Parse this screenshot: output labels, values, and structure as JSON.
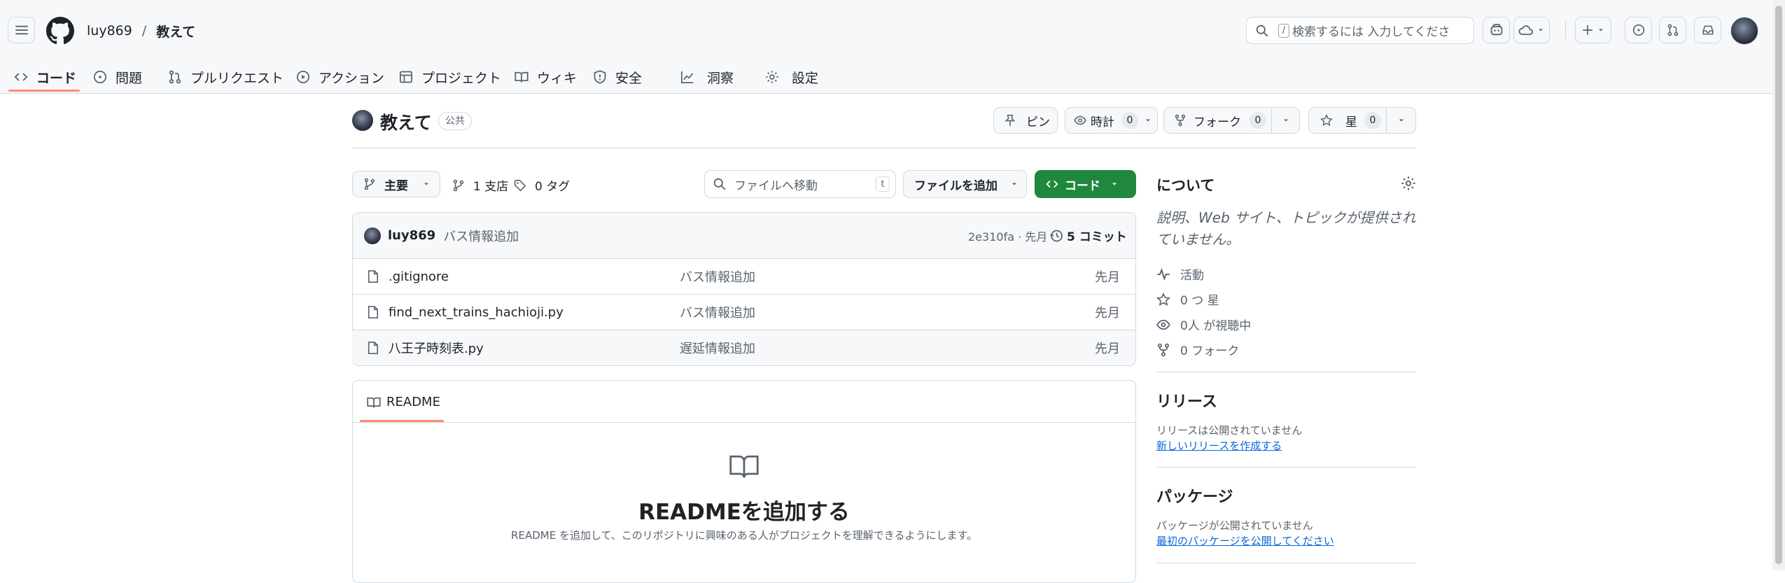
{
  "header": {
    "owner": "luy869",
    "separator": "/",
    "repo": "教えて",
    "search_placeholder": "検索するには 入力してくださ",
    "search_kbd": "/"
  },
  "nav_tabs": [
    {
      "label": "コード",
      "icon": "code-icon",
      "selected": true
    },
    {
      "label": "問題",
      "icon": "issue-icon"
    },
    {
      "label": "プルリクエスト",
      "icon": "pull-request-icon"
    },
    {
      "label": "アクション",
      "icon": "play-icon"
    },
    {
      "label": "プロジェクト",
      "icon": "table-icon"
    },
    {
      "label": "ウィキ",
      "icon": "book-icon"
    },
    {
      "label": "安全",
      "icon": "shield-icon"
    },
    {
      "label": "洞察",
      "icon": "graph-icon"
    },
    {
      "label": "設定",
      "icon": "gear-icon"
    }
  ],
  "repo_header": {
    "name": "教えて",
    "visibility": "公共",
    "pin_label": "ピン",
    "watch_label": "時計",
    "watch_count": "0",
    "fork_label": "フォーク",
    "fork_count": "0",
    "star_label": "星",
    "star_count": "0"
  },
  "toolbar": {
    "branch": "主要",
    "branches": "1 支店",
    "tags": "0 タグ",
    "goto_placeholder": "ファイルへ移動",
    "goto_kbd": "t",
    "add_file": "ファイルを追加",
    "code": "コード"
  },
  "commit": {
    "author": "luy869",
    "message": "バス情報追加",
    "hash_time": "2e310fa · 先月",
    "commits": "5 コミット"
  },
  "files": [
    {
      "name": ".gitignore",
      "message": "バス情報追加",
      "time": "先月"
    },
    {
      "name": "find_next_trains_hachioji.py",
      "message": "バス情報追加",
      "time": "先月"
    },
    {
      "name": "八王子時刻表.py",
      "message": "遅延情報追加",
      "time": "先月"
    }
  ],
  "readme": {
    "tab": "README",
    "title": "READMEを追加する",
    "desc": "README を追加して、このリポジトリに興味のある人がプロジェクトを理解できるようにします。"
  },
  "sidebar": {
    "about_title": "について",
    "about_desc": "説明、Web サイト、トピックが提供されていません。",
    "activity": "活動",
    "stars": "0 つ 星",
    "watching": "0人 が視聴中",
    "forks": "0 フォーク",
    "releases_title": "リリース",
    "releases_text": "リリースは公開されていません",
    "releases_link": "新しいリリースを作成する",
    "packages_title": "パッケージ",
    "packages_text": "パッケージが公開されていません",
    "packages_link": "最初のパッケージを公開してください"
  },
  "colors": {
    "accent_underline": "#fd8c73",
    "primary_button": "#1f883d",
    "link": "#0969da",
    "border": "#d1d9e0"
  }
}
